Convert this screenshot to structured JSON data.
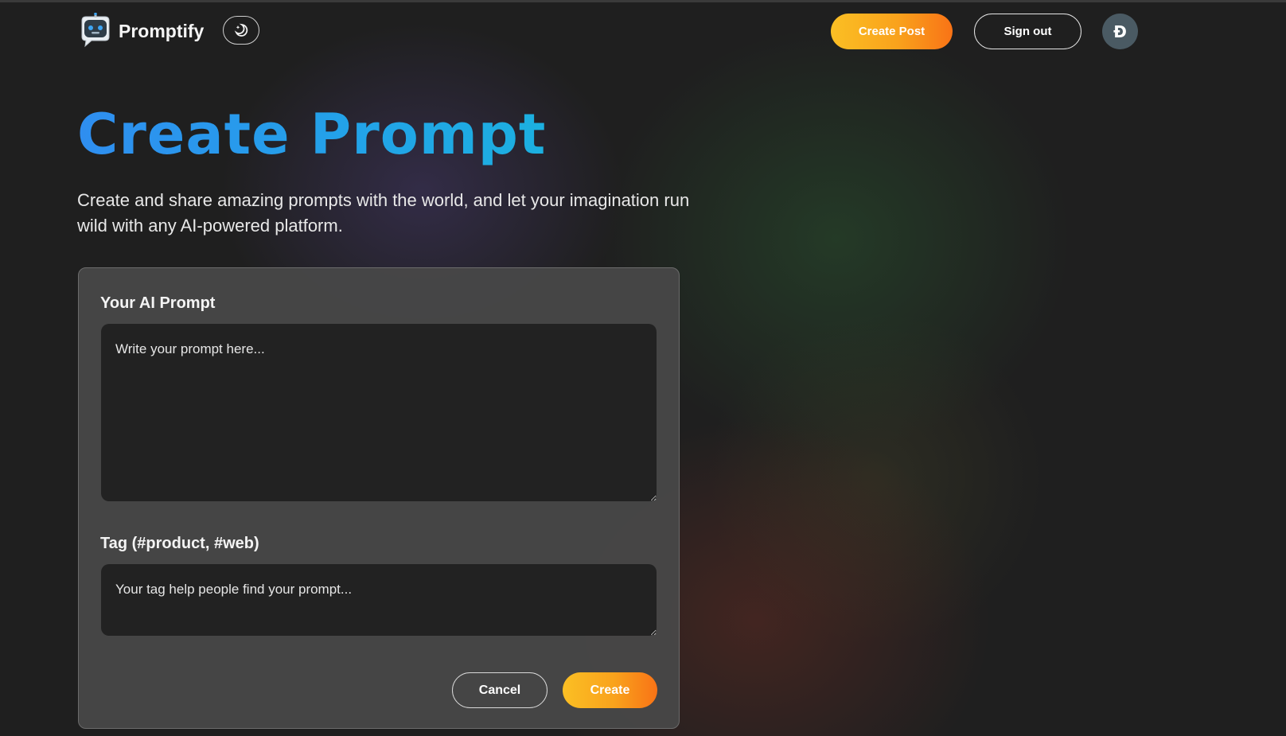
{
  "nav": {
    "brand": "Promptify",
    "logo_icon": "robot-chat-icon",
    "theme_toggle_icon": "moon-sparkle-icon",
    "create_post_label": "Create Post",
    "sign_out_label": "Sign out",
    "avatar_letter": "Đ"
  },
  "hero": {
    "title": "Create Prompt",
    "description": "Create and share amazing prompts with the world, and let your imagination run wild with any AI-powered platform."
  },
  "form": {
    "prompt_label": "Your AI Prompt",
    "prompt_value": "",
    "prompt_placeholder": "Write your prompt here...",
    "tag_label": "Tag (#product, #web)",
    "tag_value": "",
    "tag_placeholder": "Your tag help people find your prompt...",
    "cancel_label": "Cancel",
    "create_label": "Create"
  },
  "colors": {
    "accent_orange_start": "#fbbf24",
    "accent_orange_end": "#f97316",
    "title_blue": "#2f8ef0",
    "background": "#1f1f1f",
    "card": "#484848",
    "input": "#222222"
  }
}
